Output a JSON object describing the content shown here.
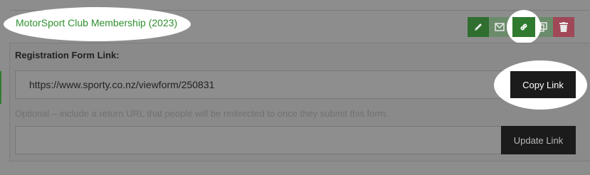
{
  "form": {
    "title": "MotorSport Club Membership (2023)",
    "actions": [
      {
        "name": "edit",
        "icon": "pencil-icon"
      },
      {
        "name": "email",
        "icon": "envelope-icon"
      },
      {
        "name": "link",
        "icon": "link-icon"
      },
      {
        "name": "copy",
        "icon": "copy-icon"
      },
      {
        "name": "delete",
        "icon": "trash-icon"
      }
    ]
  },
  "registration": {
    "label": "Registration Form Link:",
    "url": "https://www.sporty.co.nz/viewform/250831",
    "copy_label": "Copy Link",
    "optional_text": "Optional – include a return URL that people will be redirected to once they submit this form:",
    "return_url_value": "",
    "update_label": "Update Link"
  },
  "colors": {
    "title_green": "#2f8f2f",
    "action_green": "#2f6e2f",
    "delete_red": "#a04858",
    "button_dark": "#1b1b1b"
  }
}
